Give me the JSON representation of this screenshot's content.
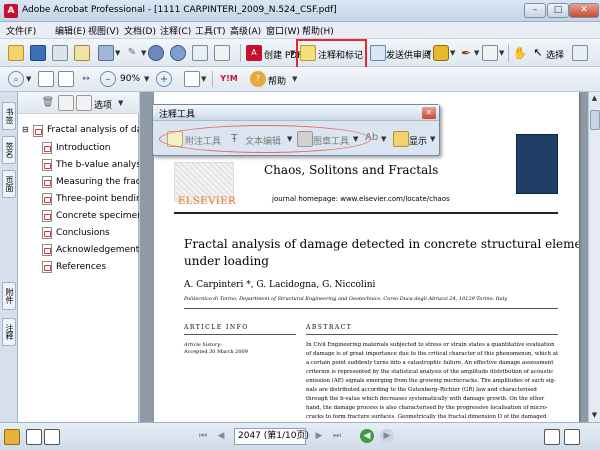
{
  "window": {
    "title": "Adobe Acrobat Professional - [1111 CARPINTERI_2009_N.524_CSF.pdf]",
    "app_icon_letter": "A",
    "minimize": "–",
    "maximize": "□",
    "close": "✕"
  },
  "menu": [
    "文件(F)",
    "编辑(E)",
    "视图(V)",
    "文档(D)",
    "注释(C)",
    "工具(T)",
    "高级(A)",
    "窗口(W)",
    "帮助(H)"
  ],
  "toolbar1": {
    "create_pdf": "创建 PDF",
    "comment_markup": "注释和标记",
    "send_review": "发送供审阅",
    "select": "选择"
  },
  "toolbar2": {
    "zoom": "90%",
    "help": "帮助"
  },
  "left_tabs": [
    "书签",
    "签名",
    "页面",
    "附件",
    "注释"
  ],
  "bookmarks": {
    "options": "选项",
    "root": "Fractal analysis of dam",
    "items": [
      "Introduction",
      "The b-value analysis",
      "Measuring the fracta",
      "Three-point bending",
      "Concrete specimen i",
      "Conclusions",
      "Acknowledgement",
      "References"
    ]
  },
  "comment_toolbar": {
    "title": "注释工具",
    "sticky_note": "附注工具",
    "text_edit": "文本编辑",
    "stamp": "图章工具",
    "show": "显示"
  },
  "document": {
    "journal": "Chaos, Solitons and Fractals",
    "homepage": "journal homepage: www.elsevier.com/locate/chaos",
    "publisher": "ELSEVIER",
    "title_line1": "Fractal analysis of damage detected in concrete structural elements",
    "title_line2": "under loading",
    "authors": "A. Carpinteri *, G. Lacidogna, G. Niccolini",
    "affiliation": "Politecnico di Torino, Department of Structural Engineering and Geotechnics, Corso Duca degli Abruzzi 24, 10129 Torino, Italy",
    "article_info": "ARTICLE INFO",
    "abstract_head": "ABSTRACT",
    "history_label": "Article history:",
    "accepted": "Accepted 30 March 2009",
    "abstract_lines": [
      "In Civil Engineering materials subjected to stress or strain states a quantitative evaluation",
      "of damage is of great importance due to the critical character of this phenomenon, which at",
      "a certain point suddenly turns into a catastrophic failure. An effective damage assessment",
      "criterion is represented by the statistical analysis of the amplitude distribution of acoustic",
      "emission (AE) signals emerging from the growing microcracks. The amplitudes of such sig-",
      "nals are distributed according to the Gutenberg–Richter (GR) law and characterised",
      "through the b-value which decreases systematically with damage growth. On the other",
      "hand, the damage process is also characterised by the progressive localisation of micro-",
      "cracks to form fracture surfaces. Geometrically the fractal dimension D of the damaged"
    ]
  },
  "status": {
    "page_field": "2047 (第1/10页)"
  },
  "colors": {
    "highlight": "#e8262e",
    "elsevier": "#e87722"
  }
}
